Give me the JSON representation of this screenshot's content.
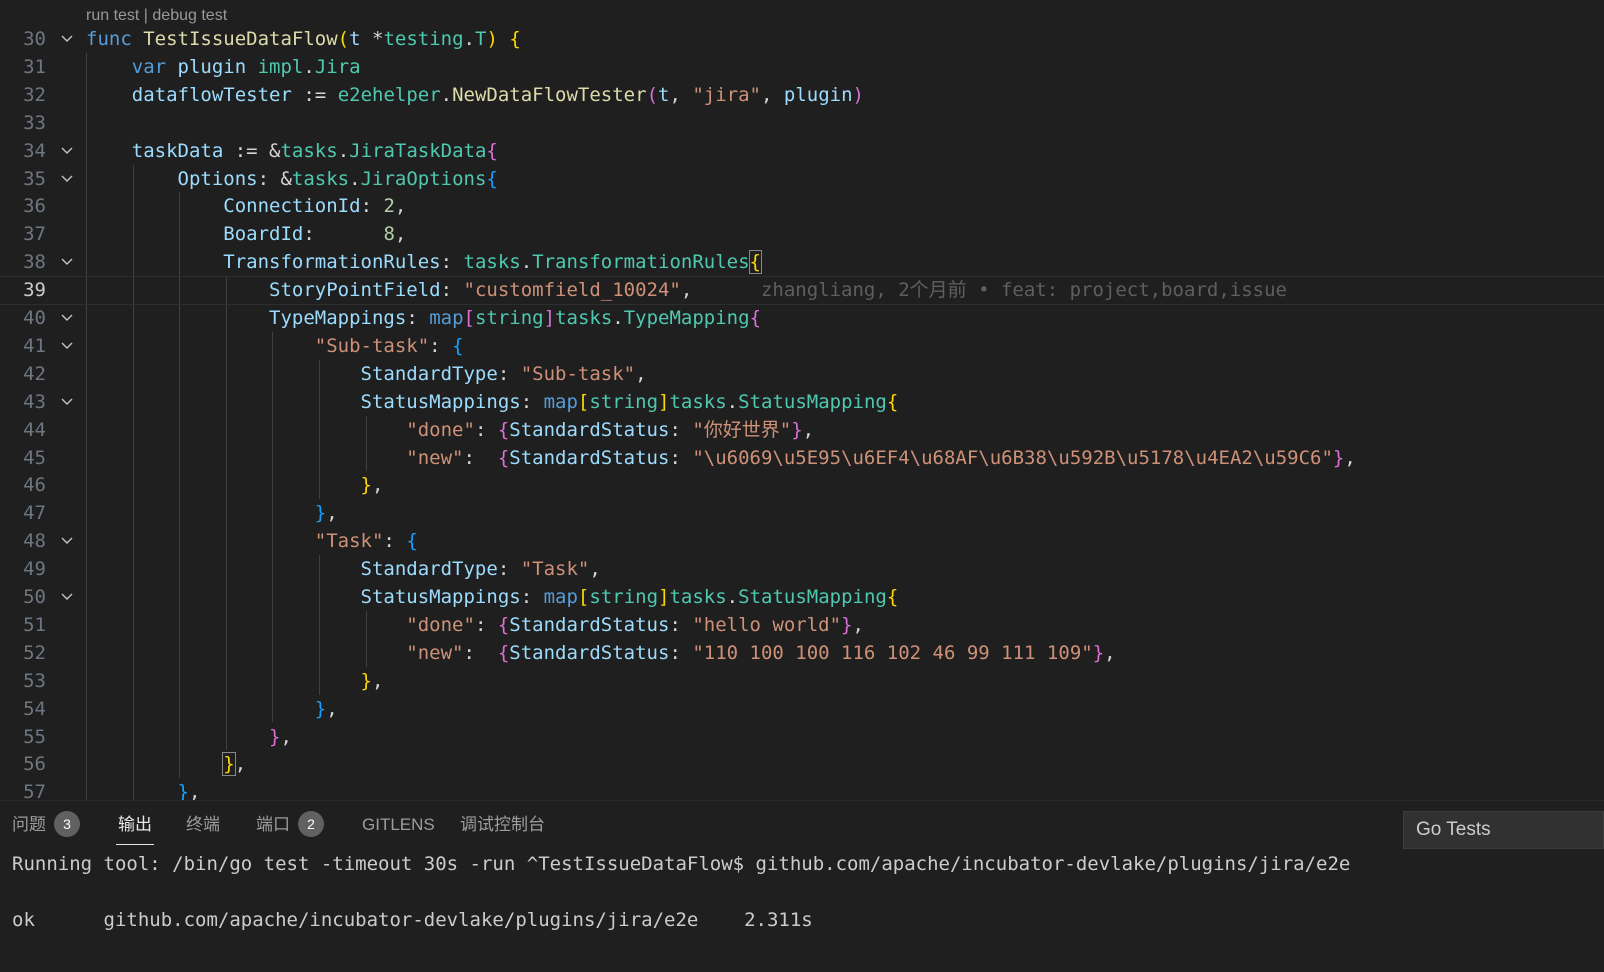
{
  "codelens": {
    "run": "run test",
    "separator": " | ",
    "debug": "debug test"
  },
  "lines": [
    {
      "n": "30",
      "fold": true,
      "current": false,
      "tokens": [
        {
          "t": "func ",
          "c": "kw"
        },
        {
          "t": "TestIssueDataFlow",
          "c": "fn"
        },
        {
          "t": "(",
          "c": "b1"
        },
        {
          "t": "t ",
          "c": "vr"
        },
        {
          "t": "*",
          "c": "op"
        },
        {
          "t": "testing",
          "c": "ty"
        },
        {
          "t": ".",
          "c": "op"
        },
        {
          "t": "T",
          "c": "ty"
        },
        {
          "t": ") {",
          "c": "b1"
        }
      ]
    },
    {
      "n": "31",
      "fold": false,
      "current": false,
      "tokens": [
        {
          "t": "    "
        },
        {
          "t": "var ",
          "c": "kw"
        },
        {
          "t": "plugin ",
          "c": "vr"
        },
        {
          "t": "impl",
          "c": "ty"
        },
        {
          "t": ".",
          "c": "op"
        },
        {
          "t": "Jira",
          "c": "ty"
        }
      ]
    },
    {
      "n": "32",
      "fold": false,
      "current": false,
      "tokens": [
        {
          "t": "    "
        },
        {
          "t": "dataflowTester ",
          "c": "vr"
        },
        {
          "t": ":= ",
          "c": "op"
        },
        {
          "t": "e2ehelper",
          "c": "ty"
        },
        {
          "t": ".",
          "c": "op"
        },
        {
          "t": "NewDataFlowTester",
          "c": "fn"
        },
        {
          "t": "(",
          "c": "b2"
        },
        {
          "t": "t",
          "c": "vr"
        },
        {
          "t": ", ",
          "c": "op"
        },
        {
          "t": "\"jira\"",
          "c": "st"
        },
        {
          "t": ", ",
          "c": "op"
        },
        {
          "t": "plugin",
          "c": "vr"
        },
        {
          "t": ")",
          "c": "b2"
        }
      ]
    },
    {
      "n": "33",
      "fold": false,
      "current": false,
      "tokens": []
    },
    {
      "n": "34",
      "fold": true,
      "current": false,
      "tokens": [
        {
          "t": "    "
        },
        {
          "t": "taskData ",
          "c": "vr"
        },
        {
          "t": ":= &",
          "c": "op"
        },
        {
          "t": "tasks",
          "c": "ty"
        },
        {
          "t": ".",
          "c": "op"
        },
        {
          "t": "JiraTaskData",
          "c": "ty"
        },
        {
          "t": "{",
          "c": "b2"
        }
      ]
    },
    {
      "n": "35",
      "fold": true,
      "current": false,
      "tokens": [
        {
          "t": "        "
        },
        {
          "t": "Options",
          "c": "vr"
        },
        {
          "t": ": &",
          "c": "op"
        },
        {
          "t": "tasks",
          "c": "ty"
        },
        {
          "t": ".",
          "c": "op"
        },
        {
          "t": "JiraOptions",
          "c": "ty"
        },
        {
          "t": "{",
          "c": "b3"
        }
      ]
    },
    {
      "n": "36",
      "fold": false,
      "current": false,
      "tokens": [
        {
          "t": "            "
        },
        {
          "t": "ConnectionId",
          "c": "vr"
        },
        {
          "t": ": ",
          "c": "op"
        },
        {
          "t": "2",
          "c": "nu"
        },
        {
          "t": ",",
          "c": "op"
        }
      ]
    },
    {
      "n": "37",
      "fold": false,
      "current": false,
      "tokens": [
        {
          "t": "            "
        },
        {
          "t": "BoardId",
          "c": "vr"
        },
        {
          "t": ":      ",
          "c": "op"
        },
        {
          "t": "8",
          "c": "nu"
        },
        {
          "t": ",",
          "c": "op"
        }
      ]
    },
    {
      "n": "38",
      "fold": true,
      "current": false,
      "tokens": [
        {
          "t": "            "
        },
        {
          "t": "TransformationRules",
          "c": "vr"
        },
        {
          "t": ": ",
          "c": "op"
        },
        {
          "t": "tasks",
          "c": "ty"
        },
        {
          "t": ".",
          "c": "op"
        },
        {
          "t": "TransformationRules",
          "c": "ty"
        },
        {
          "t": "{",
          "c": "b1 bm"
        }
      ]
    },
    {
      "n": "39",
      "fold": false,
      "current": true,
      "tokens": [
        {
          "t": "                "
        },
        {
          "t": "StoryPointField",
          "c": "vr"
        },
        {
          "t": ": ",
          "c": "op"
        },
        {
          "t": "\"customfield_10024\"",
          "c": "st"
        },
        {
          "t": ",",
          "c": "op"
        },
        {
          "t": "      "
        },
        {
          "t": "zhangliang, 2个月前 • feat: project,board,issue",
          "c": "blame"
        }
      ]
    },
    {
      "n": "40",
      "fold": true,
      "current": false,
      "tokens": [
        {
          "t": "                "
        },
        {
          "t": "TypeMappings",
          "c": "vr"
        },
        {
          "t": ": ",
          "c": "op"
        },
        {
          "t": "map",
          "c": "kw"
        },
        {
          "t": "[",
          "c": "b2"
        },
        {
          "t": "string",
          "c": "ty"
        },
        {
          "t": "]",
          "c": "b2"
        },
        {
          "t": "tasks",
          "c": "ty"
        },
        {
          "t": ".",
          "c": "op"
        },
        {
          "t": "TypeMapping",
          "c": "ty"
        },
        {
          "t": "{",
          "c": "b2"
        }
      ]
    },
    {
      "n": "41",
      "fold": true,
      "current": false,
      "tokens": [
        {
          "t": "                    "
        },
        {
          "t": "\"Sub-task\"",
          "c": "st"
        },
        {
          "t": ": ",
          "c": "op"
        },
        {
          "t": "{",
          "c": "b3"
        }
      ]
    },
    {
      "n": "42",
      "fold": false,
      "current": false,
      "tokens": [
        {
          "t": "                        "
        },
        {
          "t": "StandardType",
          "c": "vr"
        },
        {
          "t": ": ",
          "c": "op"
        },
        {
          "t": "\"Sub-task\"",
          "c": "st"
        },
        {
          "t": ",",
          "c": "op"
        }
      ]
    },
    {
      "n": "43",
      "fold": true,
      "current": false,
      "tokens": [
        {
          "t": "                        "
        },
        {
          "t": "StatusMappings",
          "c": "vr"
        },
        {
          "t": ": ",
          "c": "op"
        },
        {
          "t": "map",
          "c": "kw"
        },
        {
          "t": "[",
          "c": "b1"
        },
        {
          "t": "string",
          "c": "ty"
        },
        {
          "t": "]",
          "c": "b1"
        },
        {
          "t": "tasks",
          "c": "ty"
        },
        {
          "t": ".",
          "c": "op"
        },
        {
          "t": "StatusMapping",
          "c": "ty"
        },
        {
          "t": "{",
          "c": "b1"
        }
      ]
    },
    {
      "n": "44",
      "fold": false,
      "current": false,
      "tokens": [
        {
          "t": "                            "
        },
        {
          "t": "\"done\"",
          "c": "st"
        },
        {
          "t": ": ",
          "c": "op"
        },
        {
          "t": "{",
          "c": "b2"
        },
        {
          "t": "StandardStatus",
          "c": "vr"
        },
        {
          "t": ": ",
          "c": "op"
        },
        {
          "t": "\"你好世界\"",
          "c": "st"
        },
        {
          "t": "}",
          "c": "b2"
        },
        {
          "t": ",",
          "c": "op"
        }
      ]
    },
    {
      "n": "45",
      "fold": false,
      "current": false,
      "tokens": [
        {
          "t": "                            "
        },
        {
          "t": "\"new\"",
          "c": "st"
        },
        {
          "t": ":  ",
          "c": "op"
        },
        {
          "t": "{",
          "c": "b2"
        },
        {
          "t": "StandardStatus",
          "c": "vr"
        },
        {
          "t": ": ",
          "c": "op"
        },
        {
          "t": "\"\\u6069\\u5E95\\u6EF4\\u68AF\\u6B38\\u592B\\u5178\\u4EA2\\u59C6\"",
          "c": "st"
        },
        {
          "t": "}",
          "c": "b2"
        },
        {
          "t": ",",
          "c": "op"
        }
      ]
    },
    {
      "n": "46",
      "fold": false,
      "current": false,
      "tokens": [
        {
          "t": "                        "
        },
        {
          "t": "}",
          "c": "b1"
        },
        {
          "t": ",",
          "c": "op"
        }
      ]
    },
    {
      "n": "47",
      "fold": false,
      "current": false,
      "tokens": [
        {
          "t": "                    "
        },
        {
          "t": "}",
          "c": "b3"
        },
        {
          "t": ",",
          "c": "op"
        }
      ]
    },
    {
      "n": "48",
      "fold": true,
      "current": false,
      "tokens": [
        {
          "t": "                    "
        },
        {
          "t": "\"Task\"",
          "c": "st"
        },
        {
          "t": ": ",
          "c": "op"
        },
        {
          "t": "{",
          "c": "b3"
        }
      ]
    },
    {
      "n": "49",
      "fold": false,
      "current": false,
      "tokens": [
        {
          "t": "                        "
        },
        {
          "t": "StandardType",
          "c": "vr"
        },
        {
          "t": ": ",
          "c": "op"
        },
        {
          "t": "\"Task\"",
          "c": "st"
        },
        {
          "t": ",",
          "c": "op"
        }
      ]
    },
    {
      "n": "50",
      "fold": true,
      "current": false,
      "tokens": [
        {
          "t": "                        "
        },
        {
          "t": "StatusMappings",
          "c": "vr"
        },
        {
          "t": ": ",
          "c": "op"
        },
        {
          "t": "map",
          "c": "kw"
        },
        {
          "t": "[",
          "c": "b1"
        },
        {
          "t": "string",
          "c": "ty"
        },
        {
          "t": "]",
          "c": "b1"
        },
        {
          "t": "tasks",
          "c": "ty"
        },
        {
          "t": ".",
          "c": "op"
        },
        {
          "t": "StatusMapping",
          "c": "ty"
        },
        {
          "t": "{",
          "c": "b1"
        }
      ]
    },
    {
      "n": "51",
      "fold": false,
      "current": false,
      "tokens": [
        {
          "t": "                            "
        },
        {
          "t": "\"done\"",
          "c": "st"
        },
        {
          "t": ": ",
          "c": "op"
        },
        {
          "t": "{",
          "c": "b2"
        },
        {
          "t": "StandardStatus",
          "c": "vr"
        },
        {
          "t": ": ",
          "c": "op"
        },
        {
          "t": "\"hello world\"",
          "c": "st"
        },
        {
          "t": "}",
          "c": "b2"
        },
        {
          "t": ",",
          "c": "op"
        }
      ]
    },
    {
      "n": "52",
      "fold": false,
      "current": false,
      "tokens": [
        {
          "t": "                            "
        },
        {
          "t": "\"new\"",
          "c": "st"
        },
        {
          "t": ":  ",
          "c": "op"
        },
        {
          "t": "{",
          "c": "b2"
        },
        {
          "t": "StandardStatus",
          "c": "vr"
        },
        {
          "t": ": ",
          "c": "op"
        },
        {
          "t": "\"110 100 100 116 102 46 99 111 109\"",
          "c": "st"
        },
        {
          "t": "}",
          "c": "b2"
        },
        {
          "t": ",",
          "c": "op"
        }
      ]
    },
    {
      "n": "53",
      "fold": false,
      "current": false,
      "tokens": [
        {
          "t": "                        "
        },
        {
          "t": "}",
          "c": "b1"
        },
        {
          "t": ",",
          "c": "op"
        }
      ]
    },
    {
      "n": "54",
      "fold": false,
      "current": false,
      "tokens": [
        {
          "t": "                    "
        },
        {
          "t": "}",
          "c": "b3"
        },
        {
          "t": ",",
          "c": "op"
        }
      ]
    },
    {
      "n": "55",
      "fold": false,
      "current": false,
      "tokens": [
        {
          "t": "                "
        },
        {
          "t": "}",
          "c": "b2"
        },
        {
          "t": ",",
          "c": "op"
        }
      ]
    },
    {
      "n": "56",
      "fold": false,
      "current": false,
      "tokens": [
        {
          "t": "            "
        },
        {
          "t": "}",
          "c": "b1 bm"
        },
        {
          "t": ",",
          "c": "op"
        }
      ]
    },
    {
      "n": "57",
      "fold": false,
      "current": false,
      "tokens": [
        {
          "t": "        "
        },
        {
          "t": "}",
          "c": "b3"
        },
        {
          "t": ",",
          "c": "op"
        }
      ]
    }
  ],
  "panel": {
    "tabs": [
      {
        "label": "问题",
        "badge": "3",
        "active": false
      },
      {
        "label": "输出",
        "badge": "",
        "active": true
      },
      {
        "label": "终端",
        "badge": "",
        "active": false
      },
      {
        "label": "端口",
        "badge": "2",
        "active": false
      },
      {
        "label": "GITLENS",
        "badge": "",
        "active": false
      },
      {
        "label": "调试控制台",
        "badge": "",
        "active": false
      }
    ],
    "output_channel": "Go Tests",
    "output_lines": [
      "Running tool: /bin/go test -timeout 30s -run ^TestIssueDataFlow$ github.com/apache/incubator-devlake/plugins/jira/e2e",
      "",
      "ok      github.com/apache/incubator-devlake/plugins/jira/e2e    2.311s"
    ]
  },
  "colors": {
    "background": "#1f1f1f",
    "keyword": "#569cd6",
    "function": "#dcdcaa",
    "type": "#4ec9b0",
    "variable": "#9cdcfe",
    "string": "#ce9178",
    "number": "#b5cea8",
    "bracket1": "#ffd700",
    "bracket2": "#da70d6",
    "bracket3": "#179fff"
  }
}
